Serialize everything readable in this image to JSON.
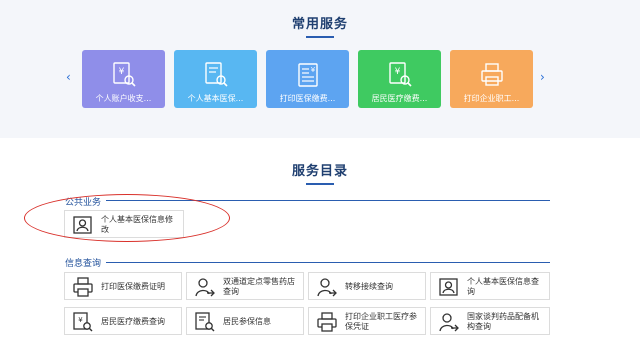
{
  "common_services": {
    "title": "常用服务",
    "prev_arrow": "‹",
    "next_arrow": "›",
    "cards": [
      {
        "label": "个人账户收支...",
        "color": "#8f8ee9",
        "icon": "receipt-search-icon"
      },
      {
        "label": "个人基本医保...",
        "color": "#58b7f2",
        "icon": "document-search-icon"
      },
      {
        "label": "打印医保缴费...",
        "color": "#5da4f1",
        "icon": "payment-document-icon"
      },
      {
        "label": "居民医疗缴费...",
        "color": "#3fca61",
        "icon": "payment-search-icon"
      },
      {
        "label": "打印企业职工...",
        "color": "#f7a95c",
        "icon": "printer-icon"
      }
    ]
  },
  "service_catalog": {
    "title": "服务目录",
    "categories": [
      {
        "name": "公共业务",
        "items": [
          {
            "label": "个人基本医保信息修改",
            "icon": "person-card-icon"
          }
        ]
      },
      {
        "name": "信息查询",
        "items": [
          {
            "label": "打印医保缴费证明",
            "icon": "printer-icon"
          },
          {
            "label": "双通道定点零售药店查询",
            "icon": "person-arrow-icon"
          },
          {
            "label": "转移接续查询",
            "icon": "person-arrow-icon"
          },
          {
            "label": "个人基本医保信息查询",
            "icon": "person-card-icon"
          },
          {
            "label": "居民医疗缴费查询",
            "icon": "receipt-search-icon"
          },
          {
            "label": "居民参保信息",
            "icon": "document-search-icon"
          },
          {
            "label": "打印企业职工医疗参保凭证",
            "icon": "printer-icon"
          },
          {
            "label": "国家谈判药品配备机构查询",
            "icon": "person-arrow-icon"
          }
        ]
      }
    ]
  }
}
